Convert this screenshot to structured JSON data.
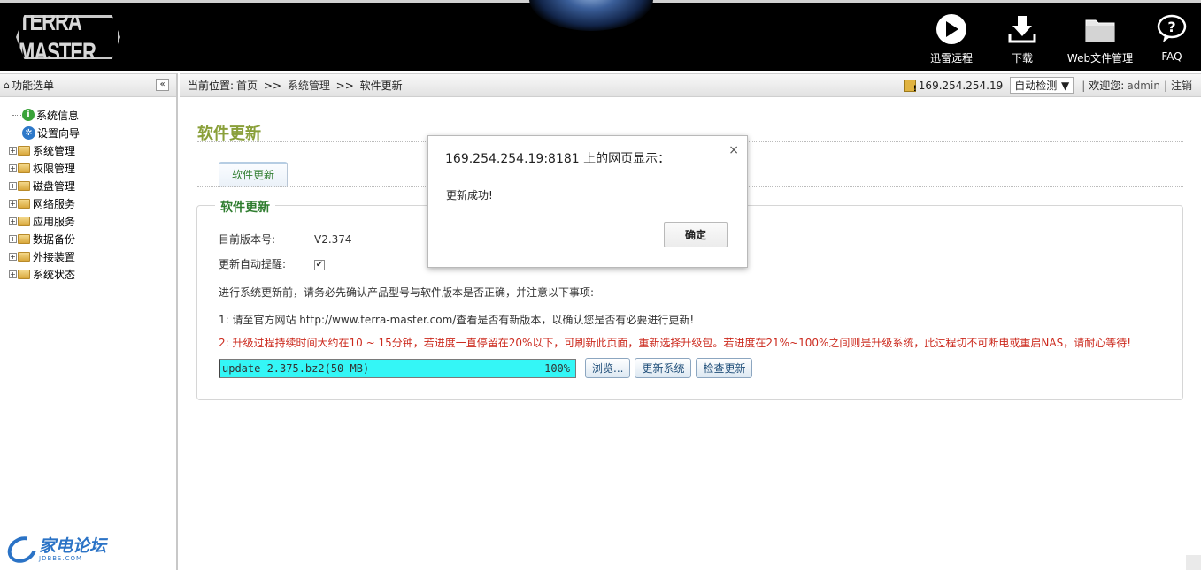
{
  "header": {
    "logo_text": "TERRA MASTER",
    "nav": [
      {
        "label": "迅雷远程",
        "icon": "thunder-remote-icon"
      },
      {
        "label": "下载",
        "icon": "download-icon"
      },
      {
        "label": "Web文件管理",
        "icon": "folder-icon"
      },
      {
        "label": "FAQ",
        "icon": "help-icon"
      }
    ]
  },
  "sidebar": {
    "title": "功能选单",
    "collapse_glyph": "«",
    "items": [
      {
        "label": "系统信息",
        "icon": "info-icon",
        "expandable": false
      },
      {
        "label": "设置向导",
        "icon": "wizard-icon",
        "expandable": false
      },
      {
        "label": "系统管理",
        "icon": "folder-icon",
        "expandable": true
      },
      {
        "label": "权限管理",
        "icon": "folder-icon",
        "expandable": true
      },
      {
        "label": "磁盘管理",
        "icon": "folder-icon",
        "expandable": true
      },
      {
        "label": "网络服务",
        "icon": "folder-icon",
        "expandable": true
      },
      {
        "label": "应用服务",
        "icon": "folder-icon",
        "expandable": true
      },
      {
        "label": "数据备份",
        "icon": "folder-icon",
        "expandable": true
      },
      {
        "label": "外接装置",
        "icon": "folder-icon",
        "expandable": true
      },
      {
        "label": "系统状态",
        "icon": "folder-icon",
        "expandable": true
      }
    ],
    "forum_logo": {
      "cn": "家电论坛",
      "en": "JDBBS.COM"
    }
  },
  "breadcrumb": {
    "prefix": "当前位置:",
    "home": "首页",
    "sep": ">>",
    "section": "系统管理",
    "current": "软件更新"
  },
  "topbar": {
    "ip": "169.254.254.19",
    "detect_select": "自动检测",
    "welcome": "欢迎您:",
    "user": "admin",
    "logout": "注销",
    "divider": "|"
  },
  "main": {
    "page_title": "软件更新",
    "tab_label": "软件更新",
    "panel_legend": "软件更新",
    "version_label": "目前版本号:",
    "version_value": "V2.374",
    "auto_remind_label": "更新自动提醒:",
    "auto_remind_checked": true,
    "intro": "进行系统更新前，请务必先确认产品型号与软件版本是否正确，并注意以下事项:",
    "note1": "1: 请至官方网站 http://www.terra-master.com/查看是否有新版本，以确认您是否有必要进行更新!",
    "note2": "2: 升级过程持续时间大约在10 ~ 15分钟，若进度一直停留在20%以下，可刷新此页面，重新选择升级包。若进度在21%~100%之间则是升级系统，此过程切不可断电或重启NAS，请耐心等待!",
    "file_name": "update-2.375.bz2(50 MB)",
    "progress_text": "100%",
    "progress": 1.0,
    "btn_browse": "浏览...",
    "btn_update": "更新系统",
    "btn_check": "检查更新"
  },
  "dialog": {
    "title": "169.254.254.19:8181 上的网页显示：",
    "message": "更新成功!",
    "ok_label": "确定",
    "close_glyph": "×"
  }
}
